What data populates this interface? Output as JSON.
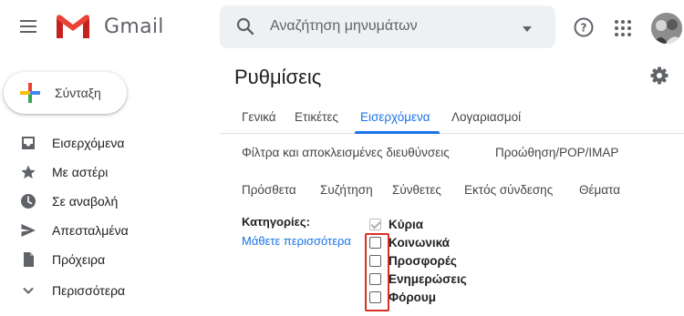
{
  "header": {
    "app_name": "Gmail",
    "search": {
      "placeholder": "Αναζήτηση μηνυμάτων"
    }
  },
  "sidebar": {
    "compose_label": "Σύνταξη",
    "items": [
      {
        "label": "Εισερχόμενα",
        "icon": "inbox-icon"
      },
      {
        "label": "Με αστέρι",
        "icon": "star-icon"
      },
      {
        "label": "Σε αναβολή",
        "icon": "clock-icon"
      },
      {
        "label": "Απεσταλμένα",
        "icon": "send-icon"
      },
      {
        "label": "Πρόχειρα",
        "icon": "draft-icon"
      },
      {
        "label": "Περισσότερα",
        "icon": "chevron-down-icon"
      }
    ]
  },
  "settings": {
    "title": "Ρυθμίσεις",
    "tabs_row1": [
      "Γενικά",
      "Ετικέτες",
      "Εισερχόμενα",
      "Λογαριασμοί"
    ],
    "tabs_row2": [
      "Φίλτρα και αποκλεισμένες διευθύνσεις",
      "Προώθηση/POP/IMAP"
    ],
    "tabs_row3": [
      "Πρόσθετα",
      "Συζήτηση",
      "Σύνθετες",
      "Εκτός σύνδεσης",
      "Θέματα"
    ],
    "active_tab": "Εισερχόμενα",
    "categories": {
      "label": "Κατηγορίες:",
      "learn_more": "Μάθετε περισσότερα",
      "options": [
        {
          "label": "Κύρια",
          "checked": true,
          "disabled": true
        },
        {
          "label": "Κοινωνικά",
          "checked": false
        },
        {
          "label": "Προσφορές",
          "checked": false
        },
        {
          "label": "Ενημερώσεις",
          "checked": false
        },
        {
          "label": "Φόρουμ",
          "checked": false
        }
      ]
    }
  },
  "colors": {
    "accent": "#1a73e8",
    "highlight": "#d93025",
    "gmail_red": "#ea4335"
  }
}
